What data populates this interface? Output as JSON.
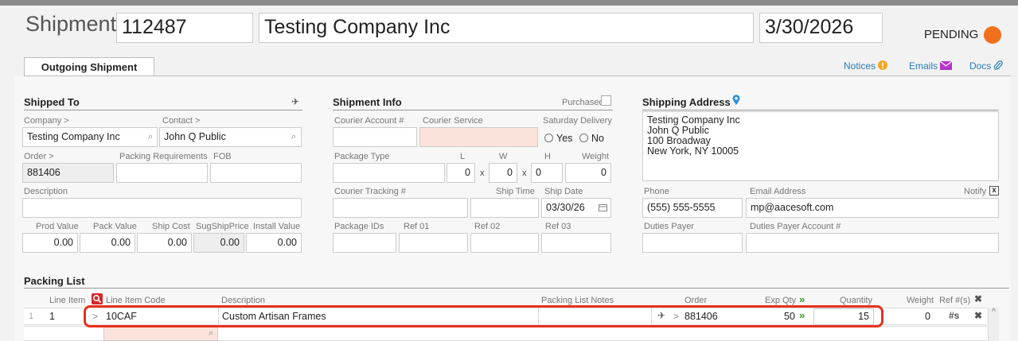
{
  "header": {
    "label": "Shipment:",
    "number": "112487",
    "company": "Testing Company Inc",
    "date": "3/30/2026",
    "status": "PENDING",
    "status_color": "#f0701d"
  },
  "tabs": {
    "active": "Outgoing Shipment"
  },
  "links": {
    "notices": "Notices",
    "emails": "Emails",
    "docs": "Docs"
  },
  "shipped_to": {
    "title": "Shipped To",
    "company_label": "Company >",
    "contact_label": "Contact >",
    "company": "Testing Company Inc",
    "contact": "John Q Public",
    "order_label": "Order >",
    "packing_req_label": "Packing Requirements",
    "fob_label": "FOB",
    "order": "881406",
    "packing_req": "",
    "fob": "",
    "description_label": "Description",
    "description": "",
    "prod_value_label": "Prod Value",
    "pack_value_label": "Pack Value",
    "ship_cost_label": "Ship Cost",
    "sug_ship_price_label": "SugShipPrice",
    "install_value_label": "Install Value",
    "prod_value": "0.00",
    "pack_value": "0.00",
    "ship_cost": "0.00",
    "sug_ship_price": "0.00",
    "install_value": "0.00"
  },
  "shipment_info": {
    "title": "Shipment Info",
    "purchased_label": "Purchased",
    "courier_account_label": "Courier Account #",
    "courier_service_label": "Courier Service",
    "saturday_label": "Saturday Delivery",
    "yes_label": "Yes",
    "no_label": "No",
    "package_type_label": "Package Type",
    "l_label": "L",
    "w_label": "W",
    "h_label": "H",
    "weight_label": "Weight",
    "l": "0",
    "w": "0",
    "h": "0",
    "weight": "0",
    "x_sep": "x",
    "tracking_label": "Courier Tracking #",
    "ship_time_label": "Ship Time",
    "ship_date_label": "Ship Date",
    "ship_date": "03/30/26",
    "package_ids_label": "Package IDs",
    "ref01_label": "Ref 01",
    "ref02_label": "Ref 02",
    "ref03_label": "Ref 03"
  },
  "shipping_address": {
    "title": "Shipping Address",
    "address": "Testing Company Inc\nJohn Q Public\n100 Broadway\nNew York, NY 10005",
    "phone_label": "Phone",
    "email_label": "Email Address",
    "notify_label": "Notify",
    "notify_mark": "x",
    "phone": "(555) 555-5555",
    "email": "mp@aacesoft.com",
    "duties_payer_label": "Duties Payer",
    "duties_account_label": "Duties Payer Account #"
  },
  "packing_list": {
    "title": "Packing List",
    "columns": {
      "line_item": "Line Item",
      "code": "Line Item Code",
      "description": "Description",
      "notes": "Packing List Notes",
      "order": "Order",
      "exp_qty": "Exp Qty",
      "quantity": "Quantity",
      "weight": "Weight",
      "refs": "Ref #(s)"
    },
    "rows": [
      {
        "index": "1",
        "line": "1",
        "code": "10CAF",
        "description": "Custom Artisan Frames",
        "notes": "",
        "order": "881406",
        "exp_qty": "50",
        "quantity": "15",
        "weight": "0",
        "refs": "#s"
      }
    ]
  }
}
